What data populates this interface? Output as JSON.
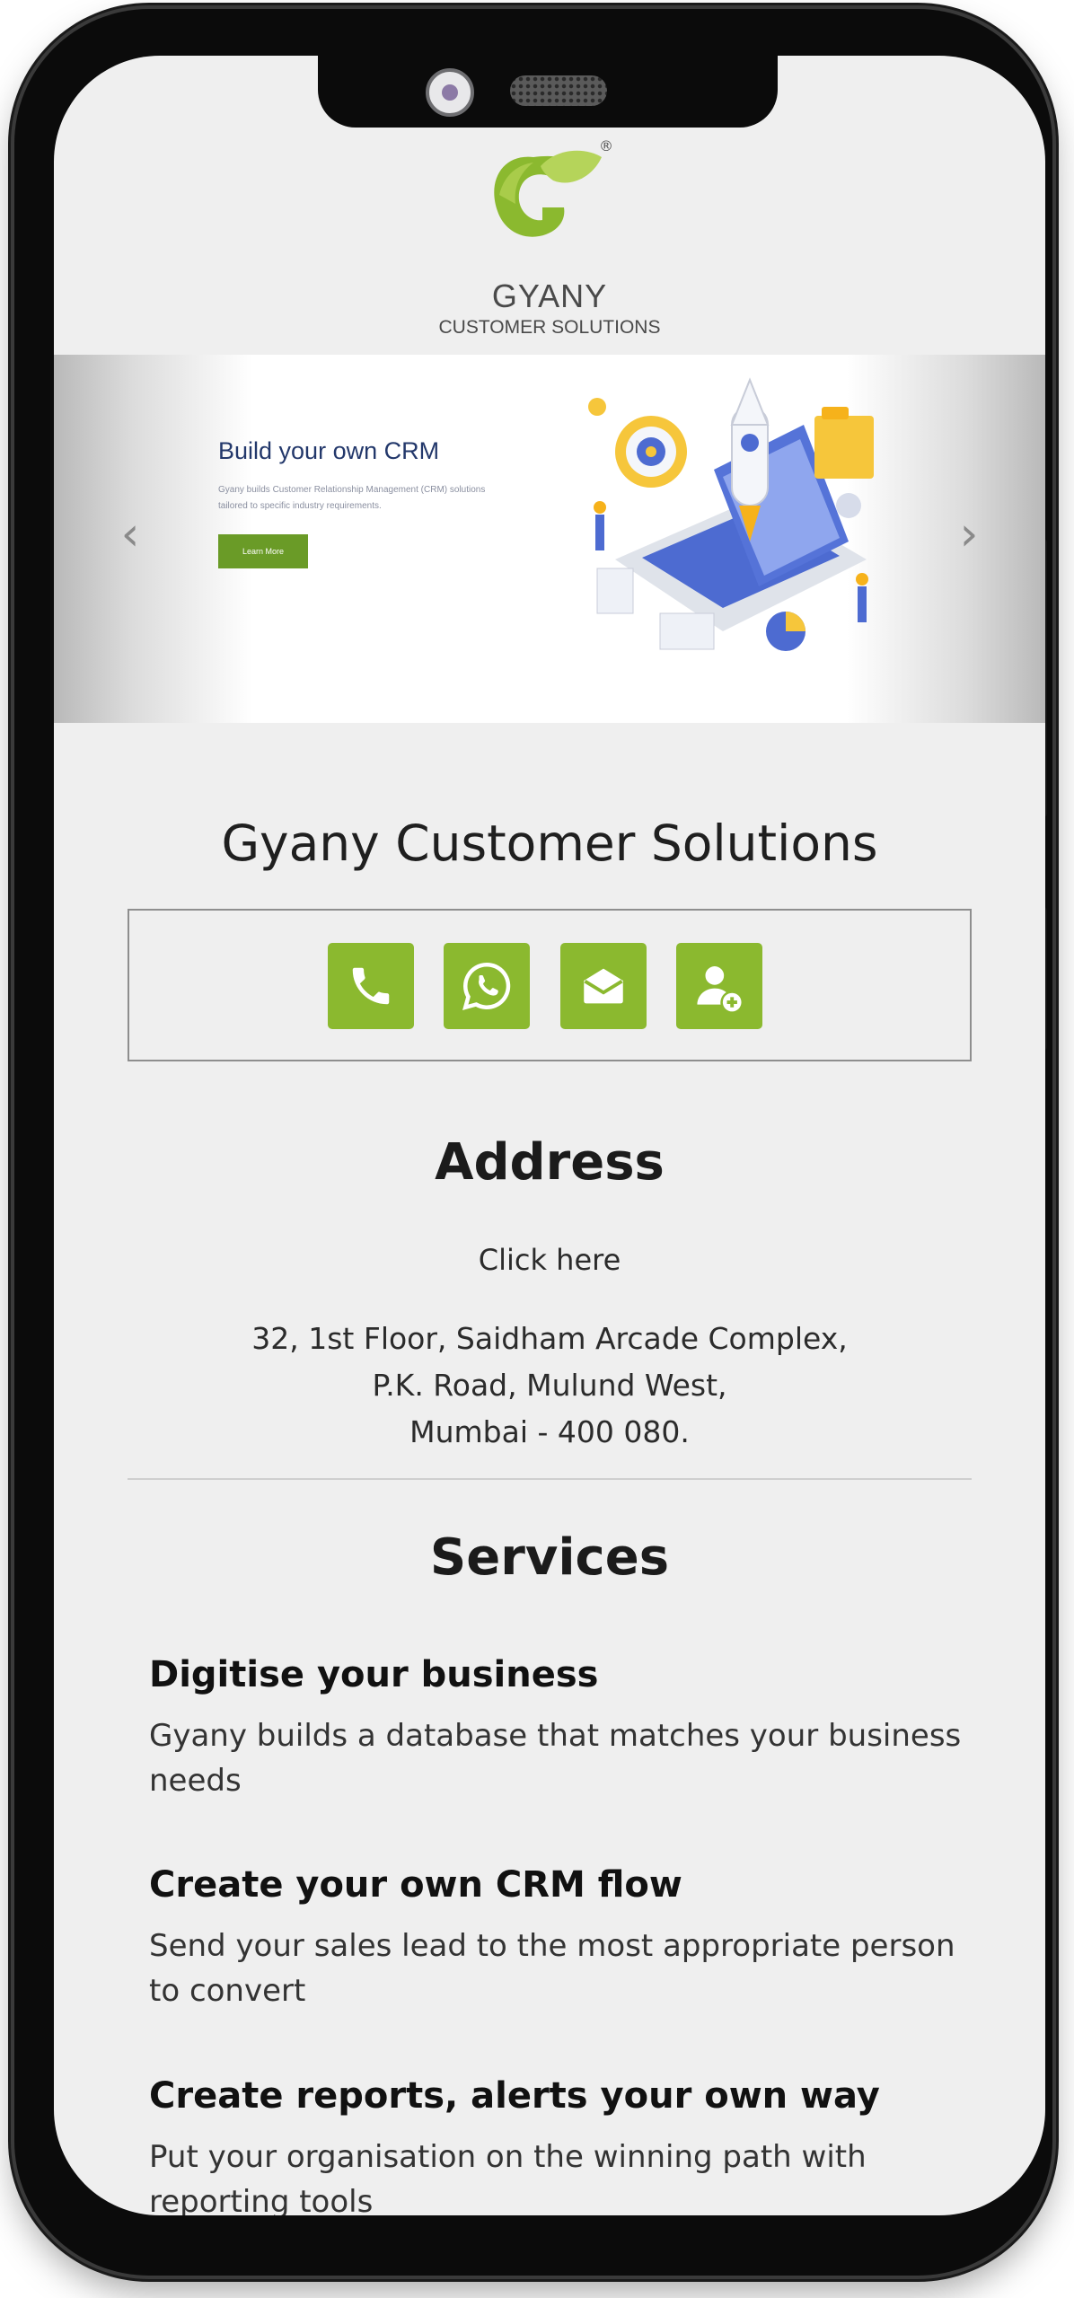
{
  "logo": {
    "name": "GYANY",
    "subtitle": "CUSTOMER SOLUTIONS",
    "registered": "®",
    "colors": {
      "primary": "#8bb92f",
      "secondary": "#b5d45a"
    }
  },
  "banner": {
    "title": "Build your own CRM",
    "description": "Gyany builds Customer Relationship Management (CRM) solutions tailored to specific industry requirements.",
    "button_label": "Learn More",
    "prev_icon": "‹",
    "next_icon": "›"
  },
  "company_name": "Gyany Customer Solutions",
  "contact_buttons": [
    {
      "name": "phone-icon"
    },
    {
      "name": "whatsapp-icon"
    },
    {
      "name": "email-icon"
    },
    {
      "name": "add-contact-icon"
    }
  ],
  "address": {
    "title": "Address",
    "link_label": "Click here",
    "line1": "32, 1st Floor, Saidham Arcade Complex,",
    "line2": "P.K. Road, Mulund West,",
    "line3": "Mumbai - 400 080."
  },
  "services": {
    "title": "Services",
    "items": [
      {
        "heading": "Digitise your business",
        "description": "Gyany builds a database that matches your business needs"
      },
      {
        "heading": "Create your own CRM flow",
        "description": "Send your sales lead to the most appropriate person to convert"
      },
      {
        "heading": "Create reports, alerts your own way",
        "description": "Put your organisation on the winning path with reporting tools"
      }
    ]
  },
  "colors": {
    "accent_green": "#8bb92f",
    "banner_title": "#23386b",
    "screen_bg": "#efefef"
  }
}
